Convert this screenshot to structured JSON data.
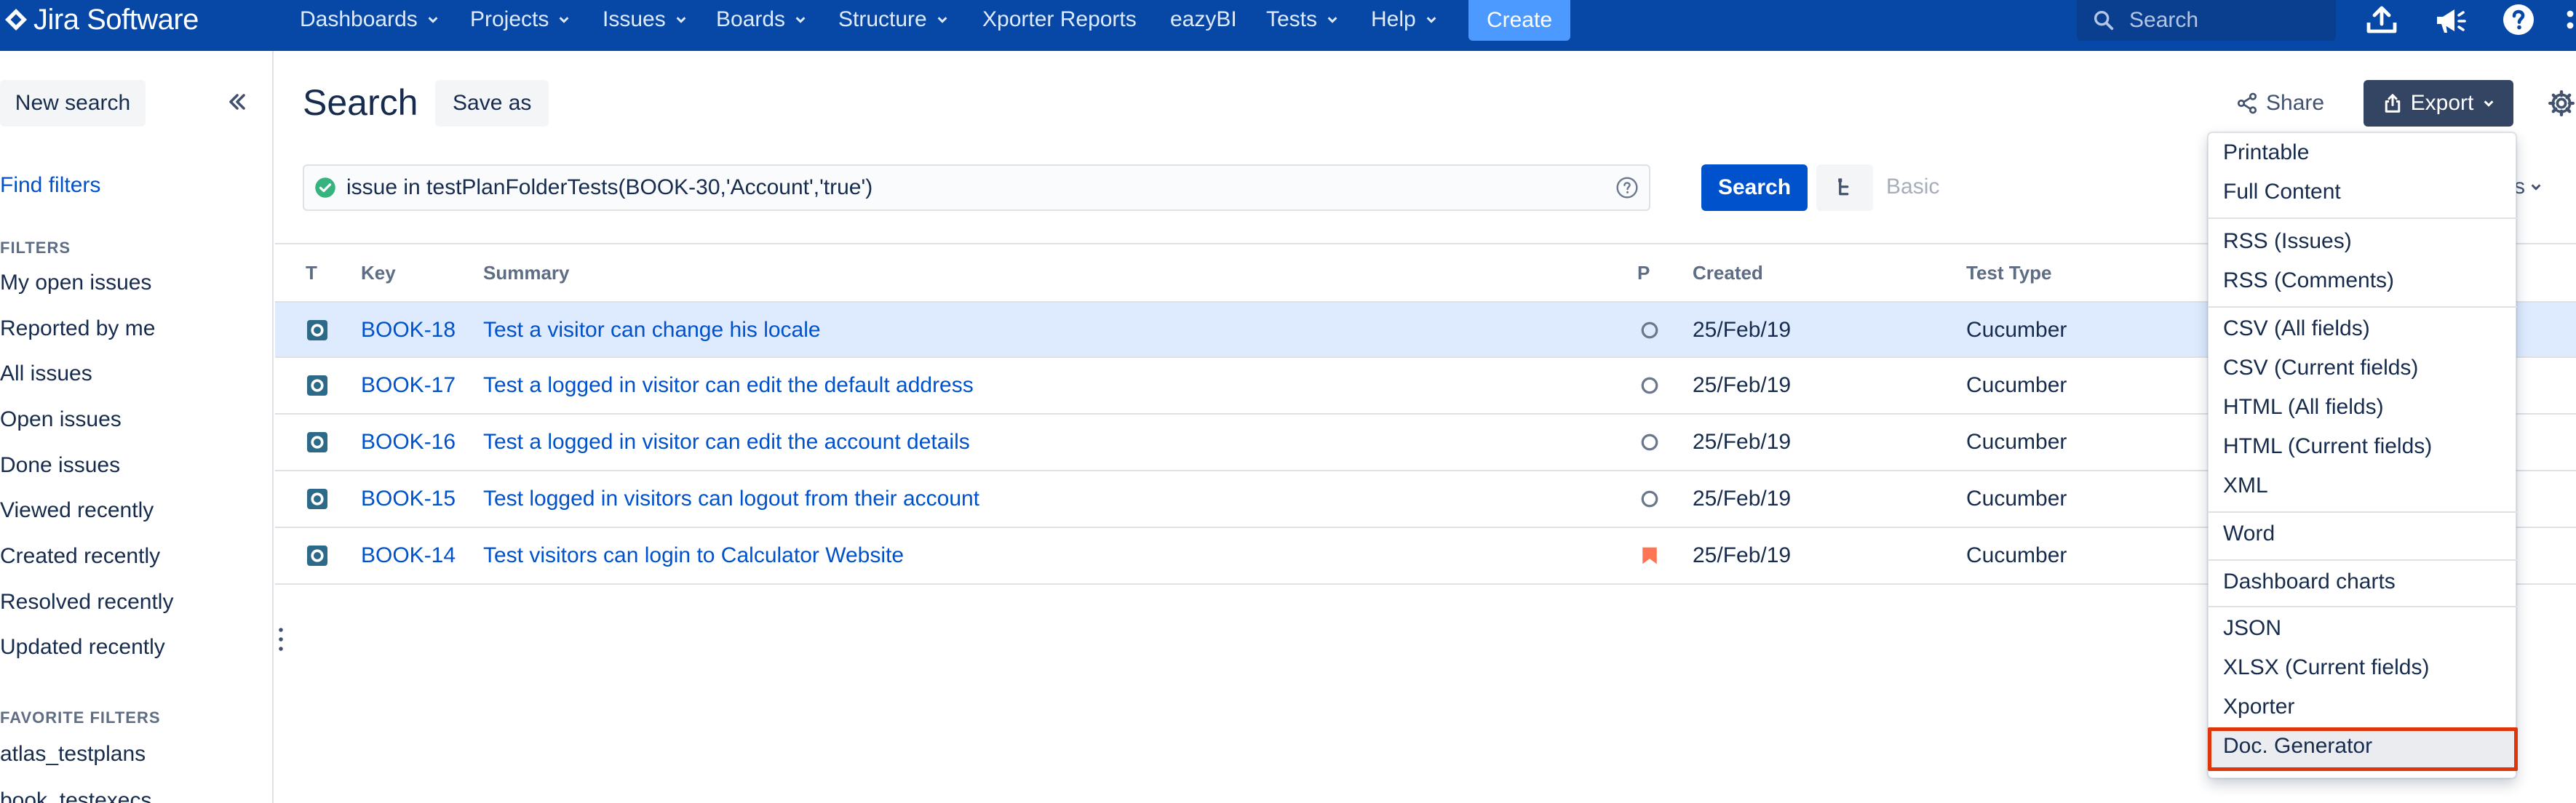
{
  "app": {
    "logo_text": "Jira Software",
    "nav": [
      {
        "label": "Dashboards",
        "has_menu": true
      },
      {
        "label": "Projects",
        "has_menu": true
      },
      {
        "label": "Issues",
        "has_menu": true
      },
      {
        "label": "Boards",
        "has_menu": true
      },
      {
        "label": "Structure",
        "has_menu": true
      },
      {
        "label": "Xporter Reports",
        "has_menu": false
      },
      {
        "label": "eazyBI",
        "has_menu": false
      },
      {
        "label": "Tests",
        "has_menu": true
      },
      {
        "label": "Help",
        "has_menu": true
      }
    ],
    "create_label": "Create",
    "search_placeholder": "Search",
    "icons": [
      "upload-icon",
      "megaphone-icon",
      "help-icon"
    ]
  },
  "sidebar": {
    "new_search": "New search",
    "find_filters": "Find filters",
    "filters_heading": "FILTERS",
    "filters": [
      "My open issues",
      "Reported by me",
      "All issues",
      "Open issues",
      "Done issues",
      "Viewed recently",
      "Created recently",
      "Resolved recently",
      "Updated recently"
    ],
    "favorites_heading": "FAVORITE FILTERS",
    "favorites": [
      "atlas_testplans",
      "book_testexecs"
    ]
  },
  "main": {
    "title": "Search",
    "save_as": "Save as",
    "share": "Share",
    "export": "Export",
    "jql": "issue in testPlanFolderTests(BOOK-30,'Account','true')",
    "search_button": "Search",
    "basic_link": "Basic",
    "columns_label": "ıns"
  },
  "table": {
    "headers": {
      "type": "T",
      "key": "Key",
      "summary": "Summary",
      "priority": "P",
      "created": "Created",
      "test_type": "Test Type"
    },
    "rows": [
      {
        "key": "BOOK-18",
        "summary": "Test a visitor can change his locale",
        "priority": "low-priority",
        "created": "25/Feb/19",
        "test_type": "Cucumber",
        "selected": true
      },
      {
        "key": "BOOK-17",
        "summary": "Test a logged in visitor can edit the default address",
        "priority": "low-priority",
        "created": "25/Feb/19",
        "test_type": "Cucumber",
        "selected": false
      },
      {
        "key": "BOOK-16",
        "summary": "Test a logged in visitor can edit the account details",
        "priority": "low-priority",
        "created": "25/Feb/19",
        "test_type": "Cucumber",
        "selected": false
      },
      {
        "key": "BOOK-15",
        "summary": "Test logged in visitors can logout from their account",
        "priority": "low-priority",
        "created": "25/Feb/19",
        "test_type": "Cucumber",
        "selected": false
      },
      {
        "key": "BOOK-14",
        "summary": "Test visitors can login to Calculator Website",
        "priority": "high-priority",
        "created": "25/Feb/19",
        "test_type": "Cucumber",
        "selected": false
      }
    ]
  },
  "export_menu": {
    "groups": [
      [
        "Printable",
        "Full Content"
      ],
      [
        "RSS (Issues)",
        "RSS (Comments)"
      ],
      [
        "CSV (All fields)",
        "CSV (Current fields)",
        "HTML (All fields)",
        "HTML (Current fields)",
        "XML"
      ],
      [
        "Word"
      ],
      [
        "Dashboard charts"
      ],
      [
        "JSON",
        "XLSX (Current fields)",
        "Xporter",
        "Doc. Generator"
      ]
    ],
    "highlighted": "Doc. Generator"
  },
  "colors": {
    "nav_bg": "#0747a6",
    "link": "#0052cc",
    "selected_row": "#deebff",
    "export_button": "#344563",
    "highlight_border": "#de350b"
  }
}
